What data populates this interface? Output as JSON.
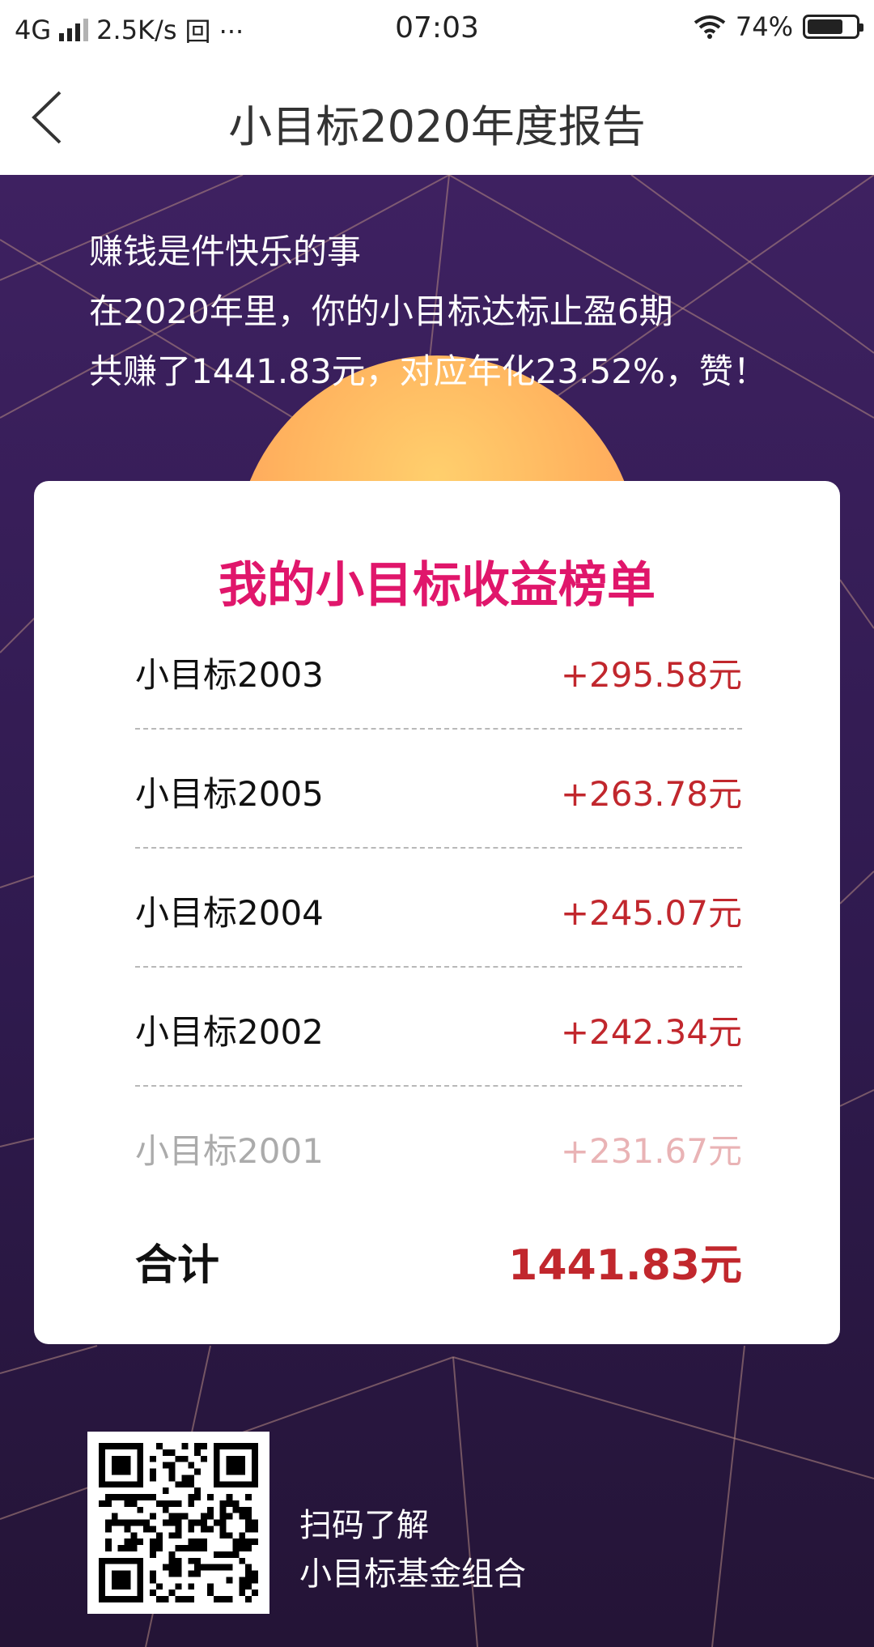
{
  "status_bar": {
    "network": "4G",
    "speed": "2.5K/s",
    "extra": "回 ···",
    "time": "07:03",
    "battery_percent": "74%",
    "battery_level": 0.74
  },
  "nav": {
    "back_icon": "chevron-left-icon",
    "title": "小目标2020年度报告"
  },
  "intro": {
    "line1": "赚钱是件快乐的事",
    "line2": "在2020年里，你的小目标达标止盈6期",
    "line3": "共赚了1441.83元，对应年化23.52%，赞！"
  },
  "card": {
    "title": "我的小目标收益榜单",
    "items": [
      {
        "name": "小目标2003",
        "amount": "+295.58元"
      },
      {
        "name": "小目标2005",
        "amount": "+263.78元"
      },
      {
        "name": "小目标2004",
        "amount": "+245.07元"
      },
      {
        "name": "小目标2002",
        "amount": "+242.34元"
      },
      {
        "name": "小目标2001",
        "amount": "+231.67元"
      }
    ],
    "total_label": "合计",
    "total_value": "1441.83元"
  },
  "qr": {
    "icon": "qr-code",
    "line1": "扫码了解",
    "line2": "小目标基金组合"
  },
  "colors": {
    "accent_title": "#e0166b",
    "amount": "#c1272d",
    "background": "#3e2161"
  }
}
